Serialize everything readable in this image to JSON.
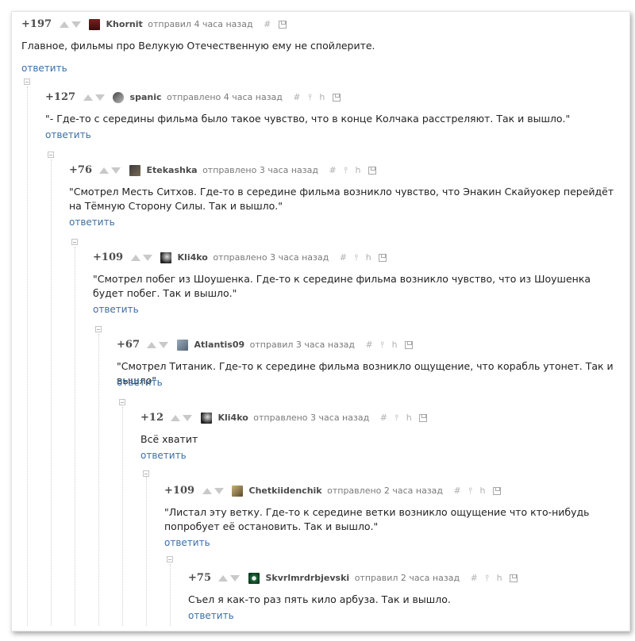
{
  "reply_label": "ответить",
  "colors": {
    "link": "#3c6fa5",
    "text": "#222222",
    "muted": "#7a7a7a"
  },
  "comments": [
    {
      "score": "+197",
      "author": "Khornit",
      "action": "отправил 4 часа назад",
      "tools": [
        "#"
      ],
      "text": "Главное, фильмы про Велукую Отечественную ему не спойлерите."
    },
    {
      "score": "+127",
      "author": "spanic",
      "action": "отправлено 4 часа назад",
      "tools": [
        "#",
        "⫯",
        "h"
      ],
      "text": "\"- Где-то с середины фильма было такое чувство, что в конце Колчака расстреляют. Так и вышло.\""
    },
    {
      "score": "+76",
      "author": "Etekashka",
      "action": "отправлено 3 часа назад",
      "tools": [
        "#",
        "⫯",
        "h"
      ],
      "text": "\"Смотрел Месть Ситхов. Где-то в середине фильма возникло чувство, что Энакин Скайуокер перейдёт на Тёмную Сторону Силы. Так и вышло.\""
    },
    {
      "score": "+109",
      "author": "Kli4ko",
      "action": "отправлено 3 часа назад",
      "tools": [
        "#",
        "⫯",
        "h"
      ],
      "text": "\"Смотрел побег из Шоушенка. Где-то к середине фильма возникло чувство, что из Шоушенка будет побег. Так и вышло.\""
    },
    {
      "score": "+67",
      "author": "Atlantis09",
      "action": "отправил 3 часа назад",
      "tools": [
        "#",
        "⫯",
        "h"
      ],
      "text": "\"Смотрел Титаник. Где-то к середине фильма возникло ощущение, что корабль утонет. Так и вышло\""
    },
    {
      "score": "+12",
      "author": "Kli4ko",
      "action": "отправлено 3 часа назад",
      "tools": [
        "#",
        "⫯",
        "h"
      ],
      "text": "Всё хватит"
    },
    {
      "score": "+109",
      "author": "Chetkiidenchik",
      "action": "отправлено 2 часа назад",
      "tools": [
        "#",
        "⫯",
        "h"
      ],
      "text": "\"Листал эту ветку. Где-то к середине ветки возникло ощущение что кто-нибудь попробует её остановить. Так и вышло.\""
    },
    {
      "score": "+75",
      "author": "Skvrlmrdrbjevski",
      "action": "отправил 2 часа назад",
      "tools": [
        "#",
        "⫯",
        "h"
      ],
      "text": "Съел я как-то раз пять кило арбуза. Так и вышло."
    }
  ]
}
